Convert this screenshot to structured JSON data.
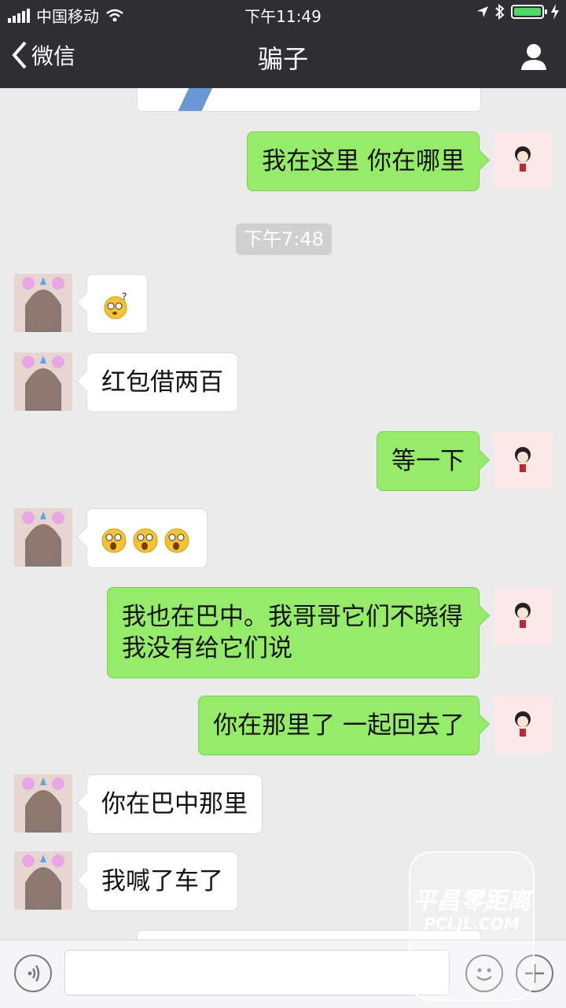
{
  "status_bar": {
    "carrier": "中国移动",
    "time": "下午11:49"
  },
  "nav": {
    "back_label": "微信",
    "title": "骗子"
  },
  "time_pill": "下午7:48",
  "messages": [
    {
      "side": "out",
      "text": "我在这里 你在哪里"
    },
    {
      "side": "in",
      "emoji": "confused-face"
    },
    {
      "side": "in",
      "text": "红包借两百"
    },
    {
      "side": "out",
      "text": "等一下"
    },
    {
      "side": "in",
      "emoji": "shocked-face x3"
    },
    {
      "side": "out",
      "text": "我也在巴中。我哥哥它们不晓得 我没有给它们说"
    },
    {
      "side": "out",
      "text": "你在那里了 一起回去了"
    },
    {
      "side": "in",
      "text": "你在巴中那里"
    },
    {
      "side": "in",
      "text": "我喊了车了"
    }
  ],
  "input": {
    "placeholder": ""
  },
  "watermark": {
    "main": "平昌零距离",
    "sub": "PCLJL.COM"
  },
  "colors": {
    "nav_bg": "#2e2e33",
    "chat_bg": "#ebebeb",
    "outgoing": "#95ec69",
    "incoming": "#ffffff"
  }
}
